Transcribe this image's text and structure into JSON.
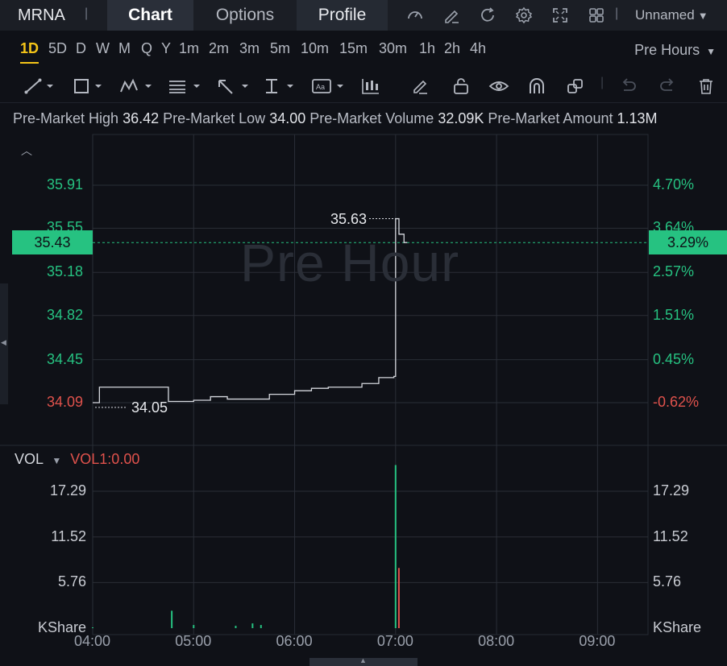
{
  "header": {
    "symbol": "MRNA",
    "tabs": [
      {
        "label": "Chart",
        "active": true
      },
      {
        "label": "Options",
        "active": false
      },
      {
        "label": "Profile",
        "active": false
      }
    ],
    "layout_name": "Unnamed",
    "icons": [
      "gauge-icon",
      "edit-icon",
      "refresh-icon",
      "settings-icon",
      "fullscreen-icon",
      "grid-icon"
    ]
  },
  "periods": {
    "items": [
      "1D",
      "5D",
      "D",
      "W",
      "M",
      "Q",
      "Y",
      "1m",
      "2m",
      "3m",
      "5m",
      "10m",
      "15m",
      "30m",
      "1h",
      "2h",
      "4h"
    ],
    "active": "1D",
    "session_label": "Pre Hours"
  },
  "toolbar": {
    "tools": [
      "trend-line-icon",
      "rectangle-icon",
      "pattern-icon",
      "fibonacci-icon",
      "arrow-icon",
      "measure-icon",
      "text-icon",
      "candles-icon",
      "pencil-icon",
      "lock-icon",
      "eye-icon",
      "magnet-icon",
      "clone-icon",
      "undo-icon",
      "redo-icon",
      "trash-icon"
    ]
  },
  "info": {
    "high_label": "Pre-Market High",
    "high_value": "36.42",
    "low_label": "Pre-Market Low",
    "low_value": "34.00",
    "volume_label": "Pre-Market Volume",
    "volume_value": "32.09K",
    "amount_label": "Pre-Market Amount",
    "amount_value": "1.13M"
  },
  "colors": {
    "up": "#26c281",
    "down": "#e0524c",
    "line": "#d5d8de",
    "accent": "#f5c518"
  },
  "price_axis": {
    "left_labels": [
      "35.91",
      "35.55",
      "35.18",
      "34.82",
      "34.45",
      "34.09"
    ],
    "right_labels": [
      "4.70%",
      "3.64%",
      "2.57%",
      "1.51%",
      "0.45%",
      "-0.62%"
    ],
    "current_price": "35.43",
    "current_change": "3.29%",
    "high_marker": "35.63",
    "low_marker": "34.05",
    "watermark": "Pre Hour"
  },
  "volume_panel": {
    "label": "VOL",
    "indicator": "VOL1:0.00",
    "axis_labels": [
      "17.29",
      "11.52",
      "5.76",
      "KShare"
    ],
    "unit": "KShare"
  },
  "time_axis": [
    "04:00",
    "05:00",
    "06:00",
    "07:00",
    "08:00",
    "09:00"
  ],
  "chart_data": {
    "type": "line",
    "x": [
      "04:00",
      "04:04",
      "04:30",
      "04:45",
      "05:00",
      "05:10",
      "05:20",
      "05:45",
      "06:00",
      "06:10",
      "06:20",
      "06:40",
      "06:50",
      "06:59",
      "07:00",
      "07:02",
      "07:05"
    ],
    "series": [
      {
        "values": [
          34.09,
          34.22,
          34.22,
          34.1,
          34.11,
          34.14,
          34.12,
          34.16,
          34.19,
          34.21,
          34.22,
          34.25,
          34.3,
          34.31,
          35.63,
          35.5,
          35.43
        ]
      }
    ],
    "ylim": [
      34.0,
      36.2
    ],
    "volume": {
      "x": [
        "04:00",
        "04:47",
        "05:00",
        "05:25",
        "05:35",
        "05:40",
        "07:00",
        "07:01"
      ],
      "values": [
        0.1,
        2.2,
        0.4,
        0.3,
        0.6,
        0.4,
        20.6,
        7.6
      ],
      "ylim": [
        0,
        21
      ]
    }
  }
}
